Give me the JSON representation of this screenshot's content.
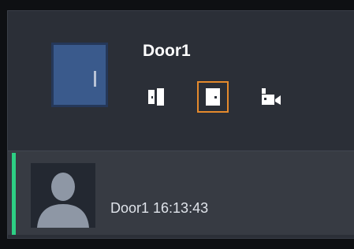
{
  "door": {
    "title": "Door1",
    "thumbnail": "door-icon"
  },
  "actions": [
    {
      "name": "open-door",
      "icon": "door-open-icon"
    },
    {
      "name": "close-door",
      "icon": "door-closed-icon",
      "selected": true,
      "highlight_color": "#e58a2c"
    },
    {
      "name": "camera",
      "icon": "camera-icon"
    }
  ],
  "event": {
    "text": "Door1 16:13:43",
    "accent_color": "#2dcf84",
    "avatar": "person-avatar-icon"
  },
  "colors": {
    "panel_bg": "#2b2f37",
    "row_bg": "#373b43",
    "door_blue": "#3a5a8c"
  }
}
